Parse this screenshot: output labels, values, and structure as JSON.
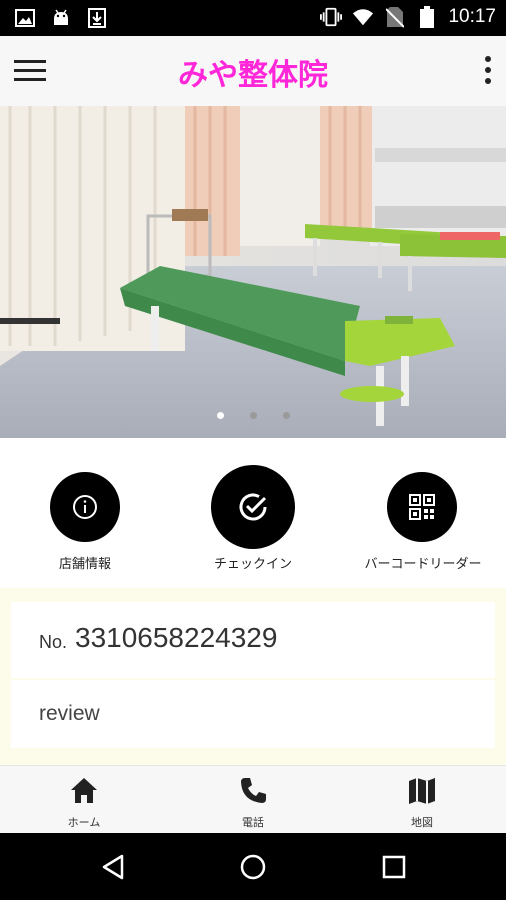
{
  "status_bar": {
    "time": "10:17",
    "left_icons": [
      "image-icon",
      "android-icon",
      "download-icon"
    ],
    "right_icons": [
      "vibrate-icon",
      "wifi-icon",
      "no-sim-icon",
      "battery-icon"
    ]
  },
  "app_bar": {
    "title": "みや整体院",
    "title_color": "#ff27d9",
    "menu_icon": "hamburger-menu-icon",
    "overflow_icon": "more-vertical-icon"
  },
  "hero": {
    "slides_count": 3,
    "active_slide": 1
  },
  "actions": [
    {
      "label": "店舗情報",
      "icon": "info-icon"
    },
    {
      "label": "チェックイン",
      "icon": "check-circle-icon"
    },
    {
      "label": "バーコードリーダー",
      "icon": "qr-code-icon"
    }
  ],
  "member": {
    "prefix": "No.",
    "number": "3310658224329"
  },
  "review": {
    "label": "review"
  },
  "bottom_nav": [
    {
      "label": "ホーム",
      "icon": "home-icon"
    },
    {
      "label": "電話",
      "icon": "phone-icon"
    },
    {
      "label": "地図",
      "icon": "map-icon"
    }
  ],
  "system_nav": [
    "back-icon",
    "home-circle-icon",
    "recents-icon"
  ]
}
